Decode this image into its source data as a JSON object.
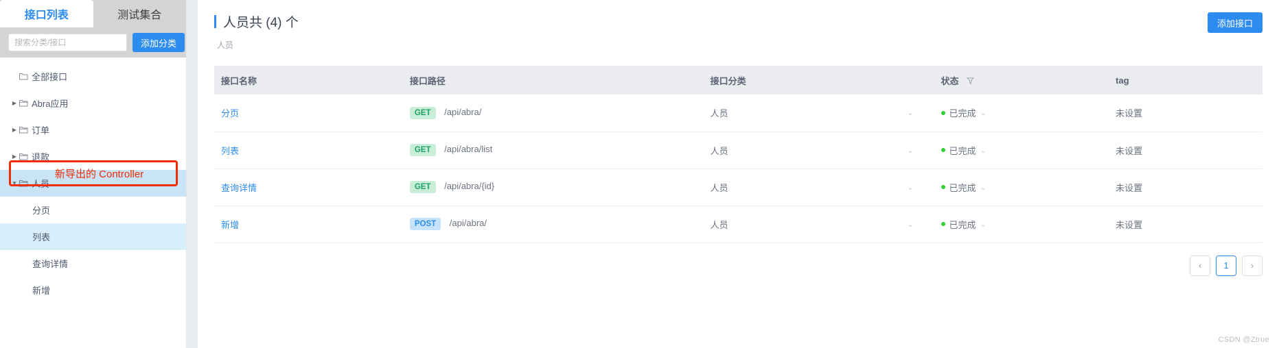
{
  "sidebar": {
    "tabs": [
      {
        "label": "接口列表",
        "active": true
      },
      {
        "label": "测试集合",
        "active": false
      }
    ],
    "search": {
      "placeholder": "搜索分类/接口",
      "value": ""
    },
    "add_category_label": "添加分类",
    "tree": [
      {
        "label": "全部接口",
        "icon": "folder-icon",
        "arrow": "",
        "selected": false
      },
      {
        "label": "Abra应用",
        "icon": "folder-icon",
        "arrow": "▶",
        "selected": false
      },
      {
        "label": "订单",
        "icon": "folder-icon",
        "arrow": "▶",
        "selected": false
      },
      {
        "label": "退款",
        "icon": "folder-icon",
        "arrow": "▶",
        "selected": false
      },
      {
        "label": "人员",
        "icon": "folder-icon",
        "arrow": "▼",
        "selected": true
      }
    ],
    "children": [
      {
        "label": "分页",
        "active": false
      },
      {
        "label": "列表",
        "active": true
      },
      {
        "label": "查询详情",
        "active": false
      },
      {
        "label": "新增",
        "active": false
      }
    ],
    "annotation": {
      "text": "新导出的 Controller",
      "color": "#f22b00"
    }
  },
  "main": {
    "title": "人员共 (4) 个",
    "breadcrumb": "人员",
    "add_api_label": "添加接口",
    "table": {
      "headers": [
        "接口名称",
        "接口路径",
        "接口分类",
        "状态",
        "tag"
      ],
      "state_filter_icon": "filter-icon",
      "rows": [
        {
          "name": "分页",
          "method": "GET",
          "path": "/api/abra/",
          "category": "人员",
          "state": "已完成",
          "tag": "未设置"
        },
        {
          "name": "列表",
          "method": "GET",
          "path": "/api/abra/list",
          "category": "人员",
          "state": "已完成",
          "tag": "未设置"
        },
        {
          "name": "查询详情",
          "method": "GET",
          "path": "/api/abra/{id}",
          "category": "人员",
          "state": "已完成",
          "tag": "未设置"
        },
        {
          "name": "新增",
          "method": "POST",
          "path": "/api/abra/",
          "category": "人员",
          "state": "已完成",
          "tag": "未设置"
        }
      ]
    },
    "pagination": {
      "prev": "‹",
      "pages": [
        "1"
      ],
      "next": "›",
      "current": "1"
    },
    "watermark": "CSDN @Ztrue"
  },
  "colors": {
    "accent": "#2d8cf0",
    "get_badge_bg": "#c8eed9",
    "get_badge_fg": "#21a365",
    "post_badge_bg": "#c7e2fb",
    "post_badge_fg": "#2d8cf0",
    "status_dot": "#32cd32",
    "annotation": "#f22b00",
    "selected_row": "#c9e3f7"
  }
}
